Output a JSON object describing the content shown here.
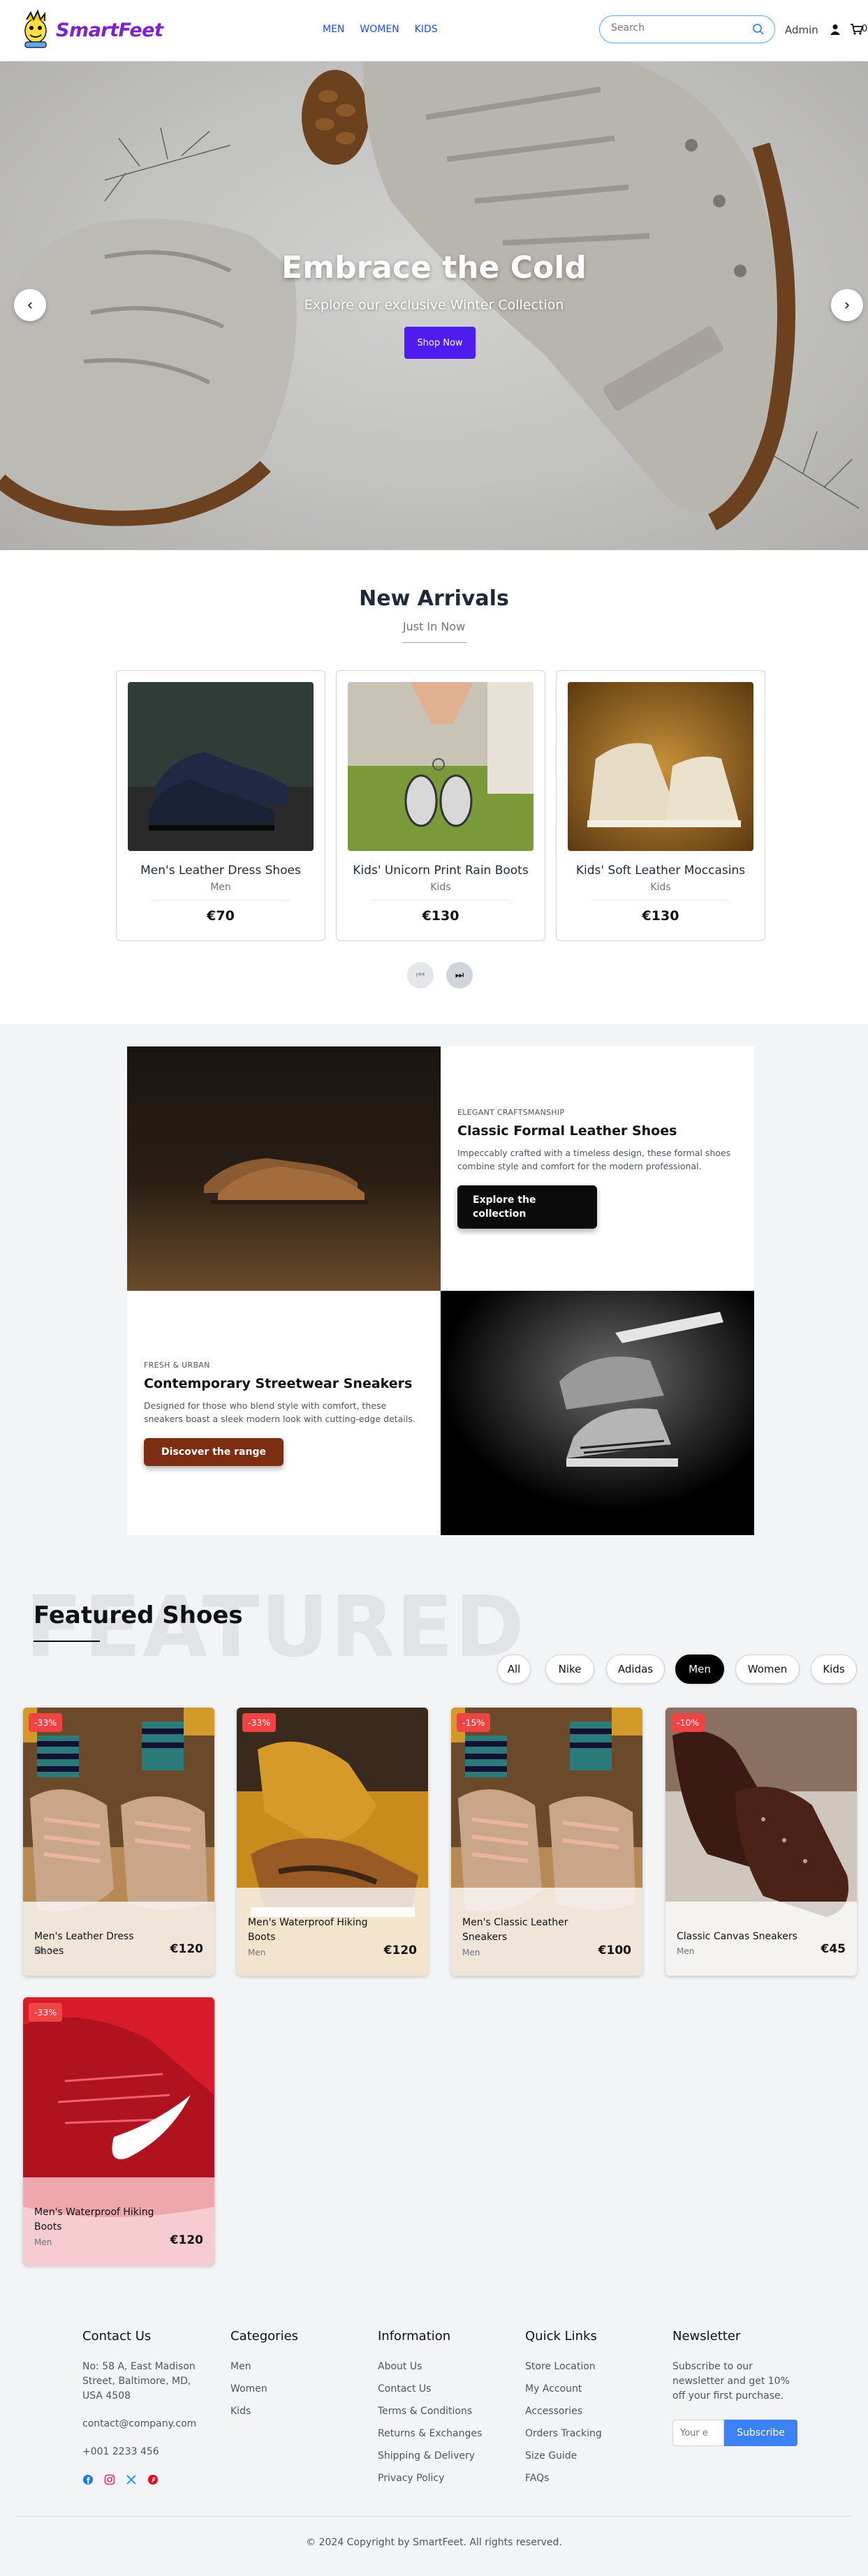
{
  "brand": {
    "name": "SmartFeet"
  },
  "nav": {
    "items": [
      "MEN",
      "WOMEN",
      "KIDS"
    ]
  },
  "search": {
    "placeholder": "Search"
  },
  "header": {
    "admin_label": "Admin",
    "cart_count": "0"
  },
  "hero": {
    "title": "Embrace the Cold",
    "subtitle": "Explore our exclusive Winter Collection",
    "cta": "Shop Now",
    "prev_glyph": "‹",
    "next_glyph": "›"
  },
  "arrivals": {
    "title": "New Arrivals",
    "subtitle": "Just In Now",
    "products": [
      {
        "name": "Men's Leather Dress Shoes",
        "category": "Men",
        "price": "€70"
      },
      {
        "name": "Kids' Unicorn Print Rain Boots",
        "category": "Kids",
        "price": "€130"
      },
      {
        "name": "Kids' Soft Leather Moccasins",
        "category": "Kids",
        "price": "€130"
      }
    ],
    "pager": {
      "prev_glyph": "⏮",
      "next_glyph": "⏭"
    }
  },
  "blocks": {
    "formal": {
      "kicker": "Elegant Craftsmanship",
      "title": "Classic Formal Leather Shoes",
      "description": "Impeccably crafted with a timeless design, these formal shoes combine style and comfort for the modern professional.",
      "cta": "Explore the collection"
    },
    "street": {
      "kicker": "Fresh & Urban",
      "title": "Contemporary Streetwear Sneakers",
      "description": "Designed for those who blend style with comfort, these sneakers boast a sleek modern look with cutting-edge details.",
      "cta": "Discover the range"
    }
  },
  "featured": {
    "background_word": "FEATURED",
    "title": "Featured Shoes",
    "filters": [
      "All",
      "Nike",
      "Adidas",
      "Men",
      "Women",
      "Kids"
    ],
    "active_filter": "Men",
    "products": [
      {
        "badge": "-33%",
        "name": "Men's Leather Dress Shoes",
        "category": "Men",
        "price": "€120"
      },
      {
        "badge": "-33%",
        "name": "Men's Waterproof Hiking Boots",
        "category": "Men",
        "price": "€120"
      },
      {
        "badge": "-15%",
        "name": "Men's Classic Leather Sneakers",
        "category": "Men",
        "price": "€100"
      },
      {
        "badge": "-10%",
        "name": "Classic Canvas Sneakers",
        "category": "Men",
        "price": "€45"
      },
      {
        "badge": "-33%",
        "name": "Men's Waterproof Hiking Boots",
        "category": "Men",
        "price": "€120"
      }
    ]
  },
  "footer": {
    "contact": {
      "title": "Contact Us",
      "address": [
        "No: 58 A, East Madison",
        "Street, Baltimore, MD,",
        "USA 4508"
      ],
      "email": "contact@company.com",
      "phone": "+001 2233 456"
    },
    "categories": {
      "title": "Categories",
      "items": [
        "Men",
        "Women",
        "Kids"
      ]
    },
    "information": {
      "title": "Information",
      "items": [
        "About Us",
        "Contact Us",
        "Terms & Conditions",
        "Returns & Exchanges",
        "Shipping & Delivery",
        "Privacy Policy"
      ]
    },
    "quick_links": {
      "title": "Quick Links",
      "items": [
        "Store Location",
        "My Account",
        "Accessories",
        "Orders Tracking",
        "Size Guide",
        "FAQs"
      ]
    },
    "newsletter": {
      "title": "Newsletter",
      "text": [
        "Subscribe to our",
        "newsletter and get 10%",
        "off your first purchase."
      ],
      "placeholder": "Your e",
      "button": "Subscribe"
    },
    "social_icons": [
      "facebook-icon",
      "instagram-icon",
      "x-icon",
      "pinterest-icon"
    ],
    "copyright": "© 2024 Copyright by SmartFeet. All rights reserved."
  },
  "colors": {
    "brand": "#7e22ce",
    "nav_link": "#1d4ed8",
    "hero_cta": "#4f1cf0",
    "badge": "#ef4444",
    "subscribe": "#3b82f6",
    "brown_cta": "#7c2d12"
  }
}
